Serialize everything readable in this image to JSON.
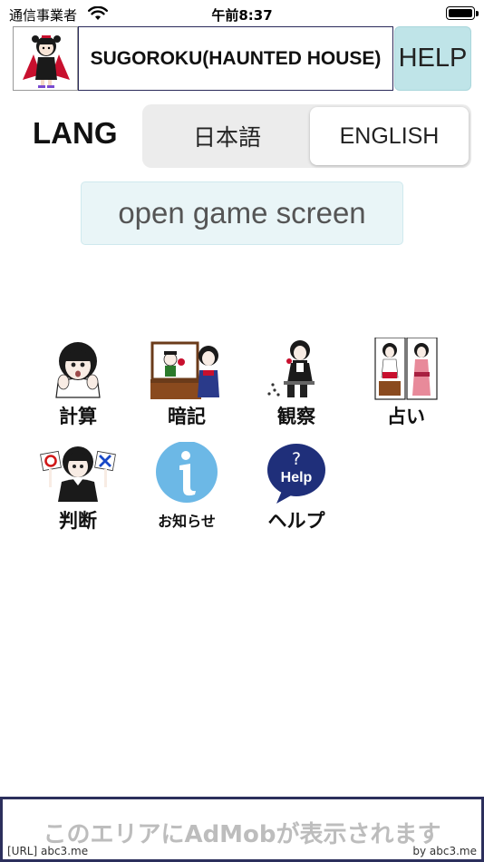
{
  "status_bar": {
    "carrier": "通信事業者",
    "time": "午前8:37"
  },
  "header": {
    "title": "SUGOROKU(HAUNTED HOUSE)",
    "help_label": "HELP"
  },
  "language": {
    "label": "LANG",
    "options": [
      "日本語",
      "ENGLISH"
    ],
    "selected": "ENGLISH"
  },
  "open_game_label": "open game screen",
  "menu": [
    {
      "label": "計算",
      "icon": "calculation-girl-icon"
    },
    {
      "label": "暗記",
      "icon": "memorize-puppet-icon"
    },
    {
      "label": "観察",
      "icon": "observation-girl-icon"
    },
    {
      "label": "占い",
      "icon": "fortune-telling-icon"
    },
    {
      "label": "判断",
      "icon": "judgement-girl-icon"
    },
    {
      "label": "お知らせ",
      "icon": "info-icon"
    },
    {
      "label": "ヘルプ",
      "icon": "help-bubble-icon"
    }
  ],
  "ad": {
    "main_text": "このエリアにAdMobが表示されます",
    "left_text": "[URL] abc3.me",
    "right_text": "by abc3.me"
  },
  "colors": {
    "help_button_bg": "#bfe4e8",
    "open_button_bg": "#e9f5f7",
    "segment_bg": "#ececec",
    "info_blue": "#6cb8e6",
    "help_navy": "#1f2f7a",
    "ad_border": "#2c2f5c"
  }
}
